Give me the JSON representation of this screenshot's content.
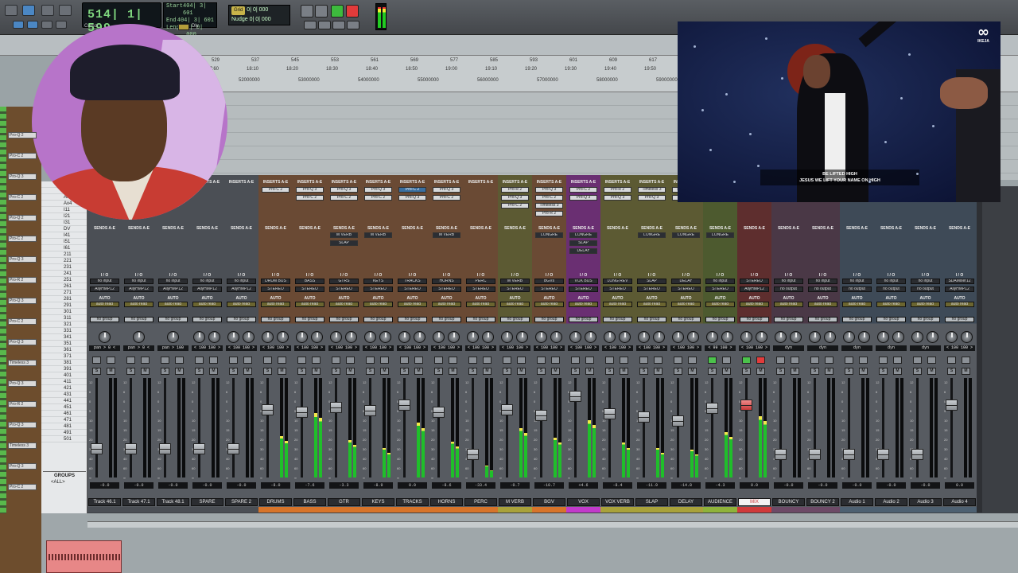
{
  "transport": {
    "counter_main": "514| 1| 599",
    "counter_caption": "Cursor",
    "start_label": "Start",
    "start_value": "404| 3| 601",
    "end_label": "End",
    "end_value": "404| 3| 601",
    "length_label": "Length",
    "length_value": "0| 0| 000",
    "dly_label": "Dly",
    "grid_label": "Grid",
    "grid_value": "0| 0| 000",
    "nudge_label": "Nudge",
    "nudge_value": "0| 0| 000"
  },
  "ruler": {
    "bars": [
      "529",
      "537",
      "545",
      "553",
      "561",
      "569",
      "577",
      "585",
      "593",
      "601",
      "609",
      "617"
    ],
    "minsecs": [
      "17:60",
      "18:10",
      "18:20",
      "18:30",
      "18:40",
      "18:50",
      "19:00",
      "19:10",
      "19:20",
      "19:30",
      "19:40",
      "19:50"
    ],
    "timecode": [
      "00:10:00:00",
      "00:10:05:00",
      "00:10:10:00",
      "00:10:20:00",
      "00:15:00:00"
    ],
    "samples": [
      "52000000",
      "53000000",
      "54000000",
      "55000000",
      "56000000",
      "57000000",
      "58000000",
      "59000000"
    ]
  },
  "left_tracks": [
    "Pro-Q 2",
    "Pro-C 2",
    "Pro-Q 3",
    "Pro-C 2",
    "Pro-Q 2",
    "Pro-C 2",
    "Pro-Q 3",
    "Pro-R 2",
    "Pro-Q 3",
    "Pro-C 2",
    "Pro-Q 3",
    "Timeless 3",
    "Pro-Q 3",
    "Pro-R 2",
    "Pro-Q 3",
    "Timeless 3",
    "Pro-Q 3",
    "Pro-C 2"
  ],
  "tracklist": [
    "Ax1",
    "Ax2",
    "Ax3",
    "Ax4",
    "I11",
    "I21",
    "I31",
    "DV",
    "I41",
    "I51",
    "I61",
    "211",
    "221",
    "231",
    "241",
    "251",
    "261",
    "271",
    "281",
    "291",
    "301",
    "311",
    "321",
    "331",
    "341",
    "351",
    "361",
    "371",
    "381",
    "391",
    "401",
    "411",
    "421",
    "431",
    "441",
    "451",
    "461",
    "471",
    "481",
    "491",
    "501"
  ],
  "groups": {
    "header": "GROUPS",
    "all": "<ALL>"
  },
  "mixer": {
    "inserts_header": "INSERTS A-E",
    "sends_header": "SENDS A-E",
    "io_header": "I / O",
    "auto_label": "AUTO",
    "group_label": "no group",
    "strips": [
      {
        "name": "Track 46.1",
        "color": "#4b4f55",
        "bar": "#4b4f55",
        "inserts": [],
        "sends": [],
        "input": "no input",
        "output": "AllyHMP12",
        "auto": "auto read",
        "pan": "pan > 0 <",
        "vol": "-0.0",
        "mute_label": "M",
        "solo_label": "S",
        "fader": 0.26,
        "meter": 0.0
      },
      {
        "name": "Track 47.1",
        "color": "#4b4f55",
        "bar": "#4b4f55",
        "inserts": [],
        "sends": [],
        "input": "no input",
        "output": "AllyHMP12",
        "auto": "auto read",
        "pan": "pan > 0 <",
        "vol": "-0.0",
        "mute_label": "M",
        "solo_label": "S",
        "fader": 0.26,
        "meter": 0.0
      },
      {
        "name": "Track 48.1",
        "color": "#4b4f55",
        "bar": "#4b4f55",
        "inserts": [],
        "sends": [],
        "input": "no input",
        "output": "AllyHMP12",
        "auto": "auto read",
        "pan": "pan > 100",
        "vol": "-0.0",
        "mute_label": "M",
        "solo_label": "S",
        "fader": 0.26,
        "meter": 0.0
      },
      {
        "name": "SPARE",
        "color": "#4b4f55",
        "bar": "#4b4f55",
        "inserts": [],
        "sends": [],
        "input": "no input",
        "output": "AllyHMP12",
        "auto": "auto read",
        "pan": "< 100 100 >",
        "vol": "-0.0",
        "mute_label": "M",
        "solo_label": "S",
        "fader": 0.26,
        "meter": 0.0
      },
      {
        "name": "SPARE 2",
        "color": "#4b4f55",
        "bar": "#4b4f55",
        "inserts": [],
        "sends": [],
        "input": "no input",
        "output": "AllyHMP12",
        "auto": "auto read",
        "pan": "< 100 100 >",
        "vol": "-0.0",
        "mute_label": "M",
        "solo_label": "S",
        "fader": 0.26,
        "meter": 0.0
      },
      {
        "name": "DRUMS",
        "color": "#6a4a34",
        "bar": "#d7742a",
        "inserts": [
          "Pro-C 2"
        ],
        "sends": [],
        "input": "DRUM BUS",
        "output": "STEREO",
        "auto": "auto read",
        "pan": "< 100 100 >",
        "vol": "-8.0",
        "mute_label": "M",
        "solo_label": "S",
        "fader": 0.7,
        "meter": 0.42
      },
      {
        "name": "BASS",
        "color": "#6a4a34",
        "bar": "#d7742a",
        "inserts": [
          "Pro-Q 3",
          "Pro-C 2"
        ],
        "sends": [],
        "input": "BASS",
        "output": "STEREO",
        "auto": "auto read",
        "pan": "< 100 100 >",
        "vol": "-7.6",
        "mute_label": "M",
        "solo_label": "S",
        "fader": 0.68,
        "meter": 0.65
      },
      {
        "name": "GTR",
        "color": "#6a4a34",
        "bar": "#d7742a",
        "inserts": [
          "Pro-Q 3",
          "Pro-C 2"
        ],
        "sends": [
          "M VERB",
          "SLAP"
        ],
        "input": "GTRS",
        "output": "STEREO",
        "auto": "auto read",
        "pan": "< 100 100 >",
        "vol": "-3.3",
        "mute_label": "M",
        "solo_label": "S",
        "fader": 0.73,
        "meter": 0.38
      },
      {
        "name": "KEYS",
        "color": "#6a4a34",
        "bar": "#d7742a",
        "inserts": [
          "Pro-Q 3",
          "Pro-C 2"
        ],
        "sends": [
          "M VERB"
        ],
        "input": "KEYS",
        "output": "STEREO",
        "auto": "auto read",
        "pan": "< 100 100 >",
        "vol": "-8.9",
        "mute_label": "M",
        "solo_label": "S",
        "fader": 0.69,
        "meter": 0.3
      },
      {
        "name": "TRACKS",
        "color": "#6a4a34",
        "bar": "#d7742a",
        "inserts": [
          "Pro-C 2",
          "Pro-Q 3"
        ],
        "sends": [],
        "input": "TRACKS",
        "output": "STEREO",
        "auto": "auto read",
        "pan": "< 100 100 >",
        "vol": "0.0",
        "mute_label": "M",
        "solo_label": "S",
        "fader": 0.76,
        "meter": 0.55
      },
      {
        "name": "HORNS",
        "color": "#6a4a34",
        "bar": "#d7742a",
        "inserts": [
          "Pro-Q 3",
          "Pro-C 2"
        ],
        "sends": [
          "M VERB"
        ],
        "input": "HORNS",
        "output": "STEREO",
        "auto": "auto read",
        "pan": "< 100 100 >",
        "vol": "-8.6",
        "mute_label": "M",
        "solo_label": "S",
        "fader": 0.68,
        "meter": 0.36
      },
      {
        "name": "PERC",
        "color": "#6a4a34",
        "bar": "#d7742a",
        "inserts": [],
        "sends": [],
        "input": "PERC",
        "output": "STEREO",
        "auto": "auto read",
        "pan": "< 100 100 >",
        "vol": "-33.4",
        "mute_label": "M",
        "solo_label": "S",
        "fader": 0.2,
        "meter": 0.12
      },
      {
        "name": "M VERB",
        "color": "#5c5a33",
        "bar": "#a9a23a",
        "inserts": [
          "Pro-R 2",
          "Pro-Q 3",
          "Pro-C 2"
        ],
        "sends": [],
        "input": "M VERB",
        "output": "STEREO",
        "auto": "auto read",
        "pan": "< 100 100 >",
        "vol": "-0.7",
        "mute_label": "M",
        "solo_label": "S",
        "fader": 0.7,
        "meter": 0.5
      },
      {
        "name": "BGV",
        "color": "#6a4a34",
        "bar": "#d7742a",
        "inserts": [
          "Pro-Q 3",
          "Pro-C 2",
          "Timeless 3",
          "Pro-R 2"
        ],
        "sends": [
          "LONGRE"
        ],
        "input": "BGVs",
        "output": "STEREO",
        "auto": "auto read",
        "pan": "< 100 100 >",
        "vol": "-10.7",
        "mute_label": "M",
        "solo_label": "S",
        "fader": 0.64,
        "meter": 0.4
      },
      {
        "name": "VOX",
        "color": "#6a2f72",
        "bar": "#c23acb",
        "inserts": [
          "Pro-C 2",
          "Pro-Q 3"
        ],
        "sends": [
          "LONGRE",
          "SLAP",
          "DELAY"
        ],
        "input": "VOX BUS",
        "output": "STEREO",
        "auto": "auto read",
        "pan": "< 100 100 >",
        "vol": "+4.6",
        "mute_label": "M",
        "solo_label": "S",
        "fader": 0.86,
        "meter": 0.58
      },
      {
        "name": "VOX VERB",
        "color": "#5c5a33",
        "bar": "#a9a23a",
        "inserts": [
          "Pro-R 2",
          "Pro-Q 3"
        ],
        "sends": [],
        "input": "LONG REV",
        "output": "STEREO",
        "auto": "auto read",
        "pan": "< 100 100 >",
        "vol": "-8.4",
        "mute_label": "M",
        "solo_label": "S",
        "fader": 0.66,
        "meter": 0.35
      },
      {
        "name": "SLAP",
        "color": "#5c5a33",
        "bar": "#a9a23a",
        "inserts": [
          "Timeless 3",
          "Pro-Q 3"
        ],
        "sends": [
          "LONGRE"
        ],
        "input": "SLAP",
        "output": "STEREO",
        "auto": "auto read",
        "pan": "< 100 100 >",
        "vol": "-11.9",
        "mute_label": "M",
        "solo_label": "S",
        "fader": 0.62,
        "meter": 0.3
      },
      {
        "name": "DELAY",
        "color": "#5c5a33",
        "bar": "#a9a23a",
        "inserts": [
          "Timeless 3",
          "Pro-Q 3"
        ],
        "sends": [
          "LONGRE"
        ],
        "input": "DELAY",
        "output": "STEREO",
        "auto": "auto read",
        "pan": "< 100 100 >",
        "vol": "-14.8",
        "mute_label": "M",
        "solo_label": "S",
        "fader": 0.58,
        "meter": 0.28
      },
      {
        "name": "AUDIENCE",
        "color": "#4d5a2f",
        "bar": "#8fb33a",
        "inserts": [
          "Pro-Q 3"
        ],
        "sends": [
          "LONGRE"
        ],
        "input": "no input",
        "output": "STEREO",
        "auto": "auto read",
        "pan": "< 99 100 >",
        "vol": "-4.3",
        "mute_label": "M",
        "solo_label": "S",
        "fader": 0.72,
        "meter": 0.46
      },
      {
        "name": "MIX",
        "color": "#5e2e2e",
        "bar": "#d03a3a",
        "inserts": [
          "Pro-L 2"
        ],
        "sends": [],
        "input": "STEREO",
        "output": "AllyHMP12",
        "auto": "auto read",
        "pan": "< 100 100 >",
        "vol": "0.0",
        "mute_label": "M",
        "solo_label": "S",
        "fader": 0.76,
        "meter": 0.62
      },
      {
        "name": "BOUNCY",
        "color": "#4a3846",
        "bar": "#6d4a67",
        "inserts": [],
        "sends": [],
        "input": "no input",
        "output": "no output",
        "auto": "auto read",
        "pan": "dyn",
        "vol": "-0.0",
        "mute_label": "M",
        "solo_label": "S",
        "fader": 0.2,
        "meter": 0.0
      },
      {
        "name": "BOUNCY 2",
        "color": "#4a3846",
        "bar": "#6d4a67",
        "inserts": [],
        "sends": [],
        "input": "no input",
        "output": "no output",
        "auto": "auto read",
        "pan": "dyn",
        "vol": "-0.0",
        "mute_label": "M",
        "solo_label": "S",
        "fader": 0.2,
        "meter": 0.0
      },
      {
        "name": "Audio 1",
        "color": "#3e4a57",
        "bar": "#4e6172",
        "inserts": [],
        "sends": [],
        "input": "no input",
        "output": "no output",
        "auto": "auto read",
        "pan": "dyn",
        "vol": "-0.0",
        "mute_label": "M",
        "solo_label": "S",
        "fader": 0.2,
        "meter": 0.0
      },
      {
        "name": "Audio 2",
        "color": "#3e4a57",
        "bar": "#4e6172",
        "inserts": [],
        "sends": [],
        "input": "no input",
        "output": "no output",
        "auto": "auto read",
        "pan": "dyn",
        "vol": "-0.0",
        "mute_label": "M",
        "solo_label": "S",
        "fader": 0.2,
        "meter": 0.0
      },
      {
        "name": "Audio 3",
        "color": "#3e4a57",
        "bar": "#4e6172",
        "inserts": [],
        "sends": [],
        "input": "no input",
        "output": "no output",
        "auto": "auto read",
        "pan": "dyn",
        "vol": "-0.0",
        "mute_label": "M",
        "solo_label": "S",
        "fader": 0.2,
        "meter": 0.0
      },
      {
        "name": "Audio 4",
        "color": "#3e4a57",
        "bar": "#4e6172",
        "inserts": [],
        "sends": [],
        "input": "SDAMixer12",
        "output": "AllyHMP12",
        "auto": "auto read",
        "pan": "< 100 100 >",
        "vol": "0.0",
        "mute_label": "M",
        "solo_label": "S",
        "fader": 0.76,
        "meter": 0.0
      }
    ],
    "scale": [
      "12",
      "6",
      "0",
      "5",
      "10",
      "15",
      "20",
      "30",
      "40",
      "60",
      "∞"
    ]
  },
  "video": {
    "subtitle_line1": "BE LIFTED HIGH",
    "subtitle_line2": "JESUS WE LIFT YOUR NAME ON HIGH",
    "logo_symbol": "∞",
    "logo_text": "IKEJA"
  },
  "colors": {
    "counter_green": "#7ed67e",
    "record_red": "#e23b3b",
    "play_green": "#3dbb3d"
  }
}
